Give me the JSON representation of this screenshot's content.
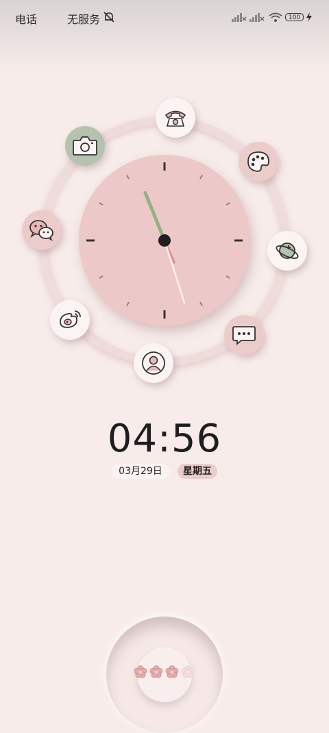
{
  "status_bar": {
    "carrier1": "电话",
    "carrier2": "无服务",
    "battery": "100"
  },
  "clock": {
    "hour": 4,
    "minute": 56,
    "time_text": "04:56",
    "date_text": "03月29日",
    "weekday_text": "星期五"
  },
  "apps": [
    {
      "name": "phone",
      "icon": "phone-icon"
    },
    {
      "name": "palette",
      "icon": "palette-icon"
    },
    {
      "name": "browser",
      "icon": "planet-icon"
    },
    {
      "name": "messages",
      "icon": "message-icon"
    },
    {
      "name": "contacts",
      "icon": "contact-icon"
    },
    {
      "name": "weibo",
      "icon": "weibo-icon"
    },
    {
      "name": "wechat",
      "icon": "wechat-icon"
    },
    {
      "name": "camera",
      "icon": "camera-icon"
    }
  ],
  "page_indicator": {
    "total": 4,
    "active": 3
  },
  "colors": {
    "background": "#f7ecea",
    "clock_face": "#ecc8c8",
    "accent_green": "#b5c3ae",
    "accent_pink": "#eccbcb"
  }
}
